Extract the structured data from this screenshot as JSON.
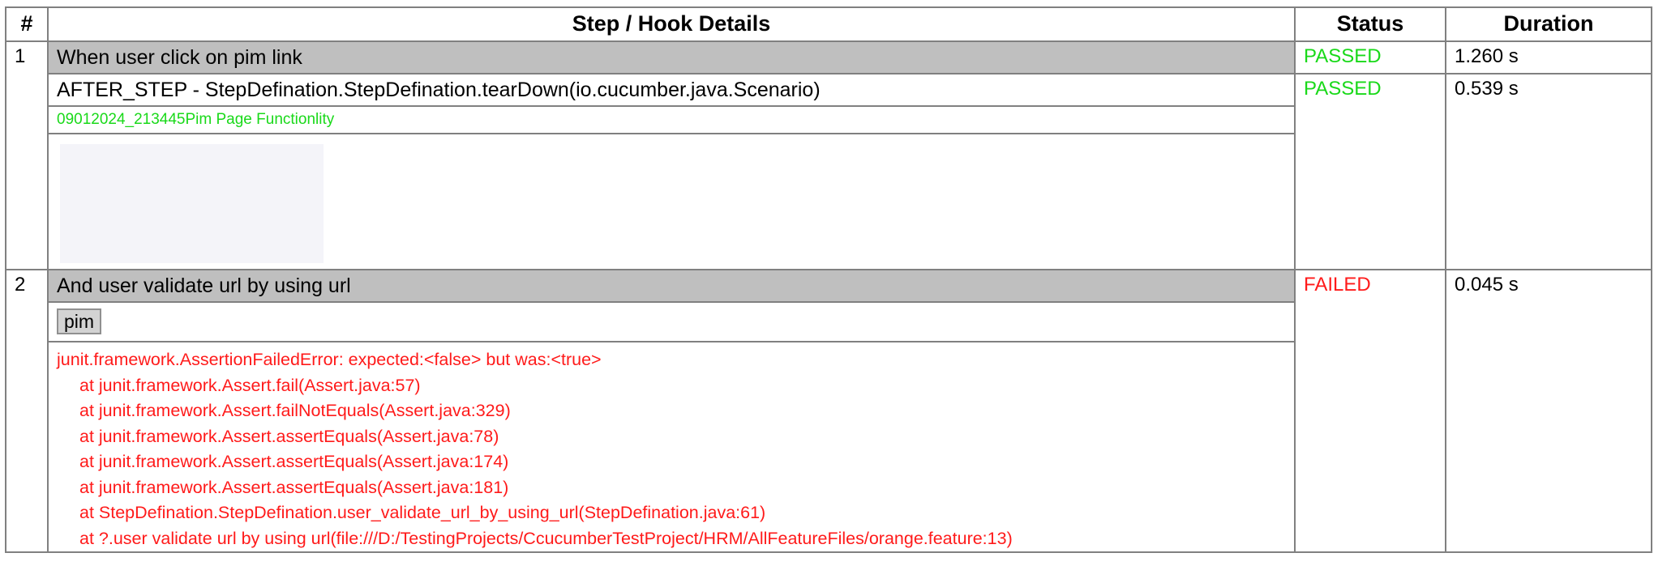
{
  "table": {
    "headers": {
      "num": "#",
      "details": "Step / Hook Details",
      "status": "Status",
      "duration": "Duration"
    },
    "steps": [
      {
        "num": "1",
        "title": "When user click on pim link",
        "status": "PASSED",
        "duration": "1.260 s",
        "hook": {
          "title": "AFTER_STEP - StepDefination.StepDefination.tearDown(io.cucumber.java.Scenario)",
          "status": "PASSED",
          "duration": "0.539 s",
          "log": "09012024_213445Pim Page Functionlity"
        }
      },
      {
        "num": "2",
        "title": "And user validate url by using url",
        "status": "FAILED",
        "duration": "0.045 s",
        "argument": "pim",
        "error": {
          "message": "junit.framework.AssertionFailedError: expected:<false> but was:<true>",
          "trace": [
            "at junit.framework.Assert.fail(Assert.java:57)",
            "at junit.framework.Assert.failNotEquals(Assert.java:329)",
            "at junit.framework.Assert.assertEquals(Assert.java:78)",
            "at junit.framework.Assert.assertEquals(Assert.java:174)",
            "at junit.framework.Assert.assertEquals(Assert.java:181)",
            "at StepDefination.StepDefination.user_validate_url_by_using_url(StepDefination.java:61)",
            "at ?.user validate url by using url(file:///D:/TestingProjects/CcucumberTestProject/HRM/AllFeatureFiles/orange.feature:13)"
          ]
        }
      }
    ]
  },
  "colors": {
    "passed": "#19d919",
    "failed": "#ff1a1a",
    "step_header_bg": "#bfbfbf"
  }
}
